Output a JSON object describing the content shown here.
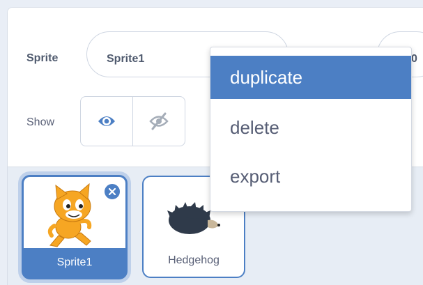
{
  "sprite_info": {
    "sprite_label": "Sprite",
    "sprite_name": "Sprite1",
    "x_value_partial": "0"
  },
  "show": {
    "label": "Show",
    "visible_icon": "eye-icon",
    "hidden_icon": "eye-slash-icon",
    "selected": "visible"
  },
  "context_menu": {
    "items": [
      {
        "label": "duplicate",
        "highlighted": true
      },
      {
        "label": "delete",
        "highlighted": false
      },
      {
        "label": "export",
        "highlighted": false
      }
    ]
  },
  "sprite_list": {
    "sprites": [
      {
        "name": "Sprite1",
        "selected": true,
        "icon": "cat-sprite-icon"
      },
      {
        "name": "Hedgehog",
        "selected": false,
        "icon": "hedgehog-sprite-icon"
      }
    ],
    "delete_badge_icon": "close-icon"
  },
  "colors": {
    "accent": "#4c7fc4",
    "text": "#575e75",
    "list_bg": "#e7edf5"
  }
}
